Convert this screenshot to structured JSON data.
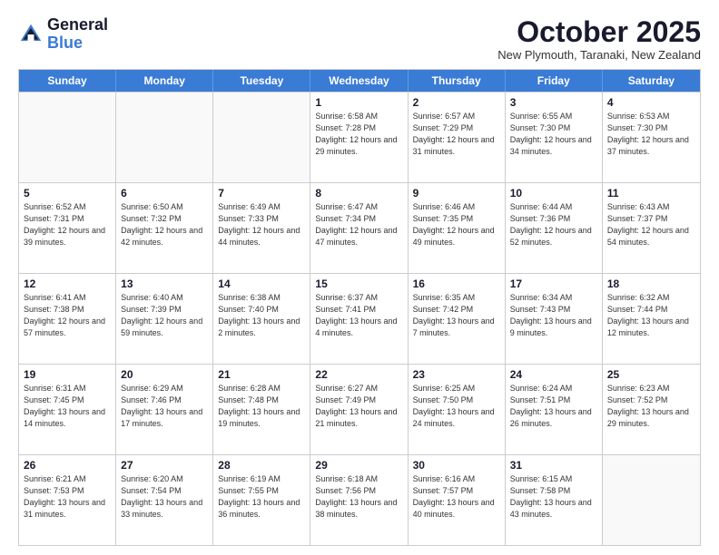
{
  "header": {
    "logo_general": "General",
    "logo_blue": "Blue",
    "month_title": "October 2025",
    "location": "New Plymouth, Taranaki, New Zealand"
  },
  "days_of_week": [
    "Sunday",
    "Monday",
    "Tuesday",
    "Wednesday",
    "Thursday",
    "Friday",
    "Saturday"
  ],
  "weeks": [
    [
      {
        "day": "",
        "empty": true
      },
      {
        "day": "",
        "empty": true
      },
      {
        "day": "",
        "empty": true
      },
      {
        "day": "1",
        "sunrise": "6:58 AM",
        "sunset": "7:28 PM",
        "daylight": "12 hours and 29 minutes."
      },
      {
        "day": "2",
        "sunrise": "6:57 AM",
        "sunset": "7:29 PM",
        "daylight": "12 hours and 31 minutes."
      },
      {
        "day": "3",
        "sunrise": "6:55 AM",
        "sunset": "7:30 PM",
        "daylight": "12 hours and 34 minutes."
      },
      {
        "day": "4",
        "sunrise": "6:53 AM",
        "sunset": "7:30 PM",
        "daylight": "12 hours and 37 minutes."
      }
    ],
    [
      {
        "day": "5",
        "sunrise": "6:52 AM",
        "sunset": "7:31 PM",
        "daylight": "12 hours and 39 minutes."
      },
      {
        "day": "6",
        "sunrise": "6:50 AM",
        "sunset": "7:32 PM",
        "daylight": "12 hours and 42 minutes."
      },
      {
        "day": "7",
        "sunrise": "6:49 AM",
        "sunset": "7:33 PM",
        "daylight": "12 hours and 44 minutes."
      },
      {
        "day": "8",
        "sunrise": "6:47 AM",
        "sunset": "7:34 PM",
        "daylight": "12 hours and 47 minutes."
      },
      {
        "day": "9",
        "sunrise": "6:46 AM",
        "sunset": "7:35 PM",
        "daylight": "12 hours and 49 minutes."
      },
      {
        "day": "10",
        "sunrise": "6:44 AM",
        "sunset": "7:36 PM",
        "daylight": "12 hours and 52 minutes."
      },
      {
        "day": "11",
        "sunrise": "6:43 AM",
        "sunset": "7:37 PM",
        "daylight": "12 hours and 54 minutes."
      }
    ],
    [
      {
        "day": "12",
        "sunrise": "6:41 AM",
        "sunset": "7:38 PM",
        "daylight": "12 hours and 57 minutes."
      },
      {
        "day": "13",
        "sunrise": "6:40 AM",
        "sunset": "7:39 PM",
        "daylight": "12 hours and 59 minutes."
      },
      {
        "day": "14",
        "sunrise": "6:38 AM",
        "sunset": "7:40 PM",
        "daylight": "13 hours and 2 minutes."
      },
      {
        "day": "15",
        "sunrise": "6:37 AM",
        "sunset": "7:41 PM",
        "daylight": "13 hours and 4 minutes."
      },
      {
        "day": "16",
        "sunrise": "6:35 AM",
        "sunset": "7:42 PM",
        "daylight": "13 hours and 7 minutes."
      },
      {
        "day": "17",
        "sunrise": "6:34 AM",
        "sunset": "7:43 PM",
        "daylight": "13 hours and 9 minutes."
      },
      {
        "day": "18",
        "sunrise": "6:32 AM",
        "sunset": "7:44 PM",
        "daylight": "13 hours and 12 minutes."
      }
    ],
    [
      {
        "day": "19",
        "sunrise": "6:31 AM",
        "sunset": "7:45 PM",
        "daylight": "13 hours and 14 minutes."
      },
      {
        "day": "20",
        "sunrise": "6:29 AM",
        "sunset": "7:46 PM",
        "daylight": "13 hours and 17 minutes."
      },
      {
        "day": "21",
        "sunrise": "6:28 AM",
        "sunset": "7:48 PM",
        "daylight": "13 hours and 19 minutes."
      },
      {
        "day": "22",
        "sunrise": "6:27 AM",
        "sunset": "7:49 PM",
        "daylight": "13 hours and 21 minutes."
      },
      {
        "day": "23",
        "sunrise": "6:25 AM",
        "sunset": "7:50 PM",
        "daylight": "13 hours and 24 minutes."
      },
      {
        "day": "24",
        "sunrise": "6:24 AM",
        "sunset": "7:51 PM",
        "daylight": "13 hours and 26 minutes."
      },
      {
        "day": "25",
        "sunrise": "6:23 AM",
        "sunset": "7:52 PM",
        "daylight": "13 hours and 29 minutes."
      }
    ],
    [
      {
        "day": "26",
        "sunrise": "6:21 AM",
        "sunset": "7:53 PM",
        "daylight": "13 hours and 31 minutes."
      },
      {
        "day": "27",
        "sunrise": "6:20 AM",
        "sunset": "7:54 PM",
        "daylight": "13 hours and 33 minutes."
      },
      {
        "day": "28",
        "sunrise": "6:19 AM",
        "sunset": "7:55 PM",
        "daylight": "13 hours and 36 minutes."
      },
      {
        "day": "29",
        "sunrise": "6:18 AM",
        "sunset": "7:56 PM",
        "daylight": "13 hours and 38 minutes."
      },
      {
        "day": "30",
        "sunrise": "6:16 AM",
        "sunset": "7:57 PM",
        "daylight": "13 hours and 40 minutes."
      },
      {
        "day": "31",
        "sunrise": "6:15 AM",
        "sunset": "7:58 PM",
        "daylight": "13 hours and 43 minutes."
      },
      {
        "day": "",
        "empty": true
      }
    ]
  ]
}
